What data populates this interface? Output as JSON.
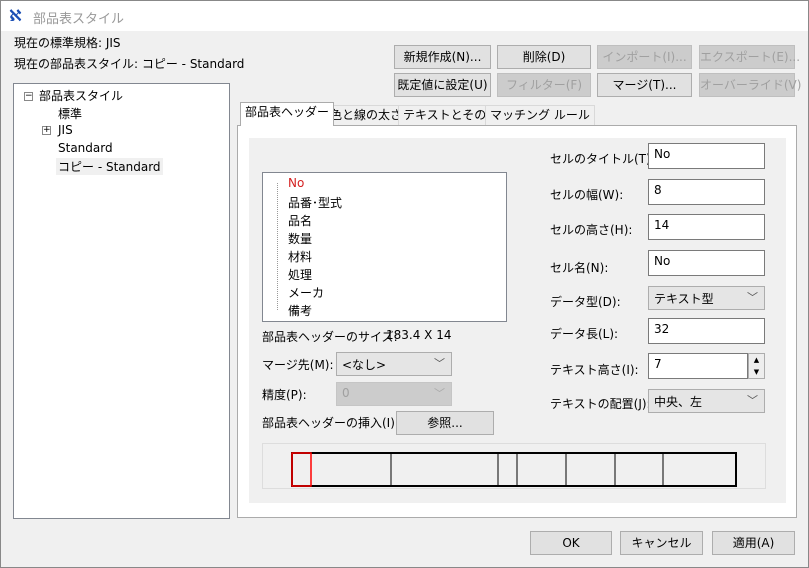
{
  "window": {
    "title": "部品表スタイル"
  },
  "info": {
    "standard": "現在の標準規格: JIS",
    "style": "現在の部品表スタイル: コピー - Standard"
  },
  "buttons": {
    "new": "新規作成(N)...",
    "delete": "削除(D)",
    "import": "インポート(I)...",
    "export": "エクスポート(E)...",
    "set_default": "既定値に設定(U)",
    "filter": "フィルター(F)",
    "merge": "マージ(T)...",
    "override": "オーバーライド(V)",
    "ok": "OK",
    "cancel": "キャンセル",
    "apply": "適用(A)",
    "browse": "参照..."
  },
  "tree": {
    "root": "部品表スタイル",
    "items": [
      "標準",
      "JIS",
      "Standard",
      "コピー - Standard"
    ],
    "selected": "コピー - Standard"
  },
  "tabs": [
    "部品表ヘッダー",
    "色と線の太さ",
    "テキストとその他",
    "マッチング ルール"
  ],
  "header_list": [
    "No",
    "品番･型式",
    "品名",
    "数量",
    "材料",
    "処理",
    "メーカ",
    "備考"
  ],
  "size": {
    "label": "部品表ヘッダーのサイズ:",
    "value": "183.4 X 14"
  },
  "merge_to": {
    "label": "マージ先(M):",
    "value": "<なし>"
  },
  "precision": {
    "label": "精度(P):",
    "value": "0"
  },
  "insert": {
    "label": "部品表ヘッダーの挿入(I):"
  },
  "fields": {
    "cell_title": {
      "label": "セルのタイトル(T):",
      "value": "No"
    },
    "cell_width": {
      "label": "セルの幅(W):",
      "value": "8"
    },
    "cell_height": {
      "label": "セルの高さ(H):",
      "value": "14"
    },
    "cell_name": {
      "label": "セル名(N):",
      "value": "No"
    },
    "data_type": {
      "label": "データ型(D):",
      "value": "テキスト型"
    },
    "data_length": {
      "label": "データ長(L):",
      "value": "32"
    },
    "text_height": {
      "label": "テキスト高さ(I):",
      "value": "7"
    },
    "text_align": {
      "label": "テキストの配置(J):",
      "value": "中央、左"
    }
  },
  "colors": {
    "selected_item": "#d42020",
    "selected_cell": "#ff0000"
  }
}
